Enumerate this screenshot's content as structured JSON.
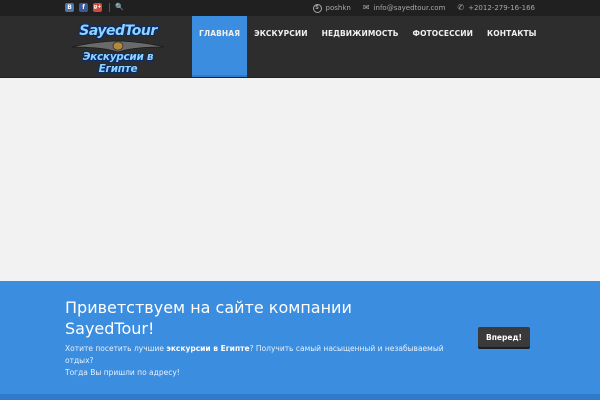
{
  "topbar": {
    "social": {
      "vk_label": "В",
      "facebook_label": "f",
      "googleplus_label": "g+"
    },
    "skype": "poshkn",
    "email": "info@sayedtour.com",
    "phone": "+2012-279-16-166"
  },
  "logo": {
    "line1": "SayedTour",
    "line2": "Экскурсии в Египте"
  },
  "nav": {
    "items": [
      {
        "label": "ГЛАВНАЯ"
      },
      {
        "label": "ЭКСКУРСИИ"
      },
      {
        "label": "НЕДВИЖИМОСТЬ"
      },
      {
        "label": "ФОТОСЕССИИ"
      },
      {
        "label": "КОНТАКТЫ"
      }
    ]
  },
  "banner": {
    "title": "Приветствуем на сайте компании SayedTour!",
    "text_before": "Хотите посетить лучшие ",
    "text_bold": "экскурсии в Египте",
    "text_after": "? Получить самый насыщенный и незабываемый отдых?",
    "text_line2": "Тогда Вы пришли по адресу!",
    "cta_label": "Вперед!"
  },
  "colors": {
    "accent": "#3b8de0",
    "header_bg": "#2d2d2d",
    "topbar_bg": "#202020",
    "button_bg": "#3a3a3a"
  }
}
